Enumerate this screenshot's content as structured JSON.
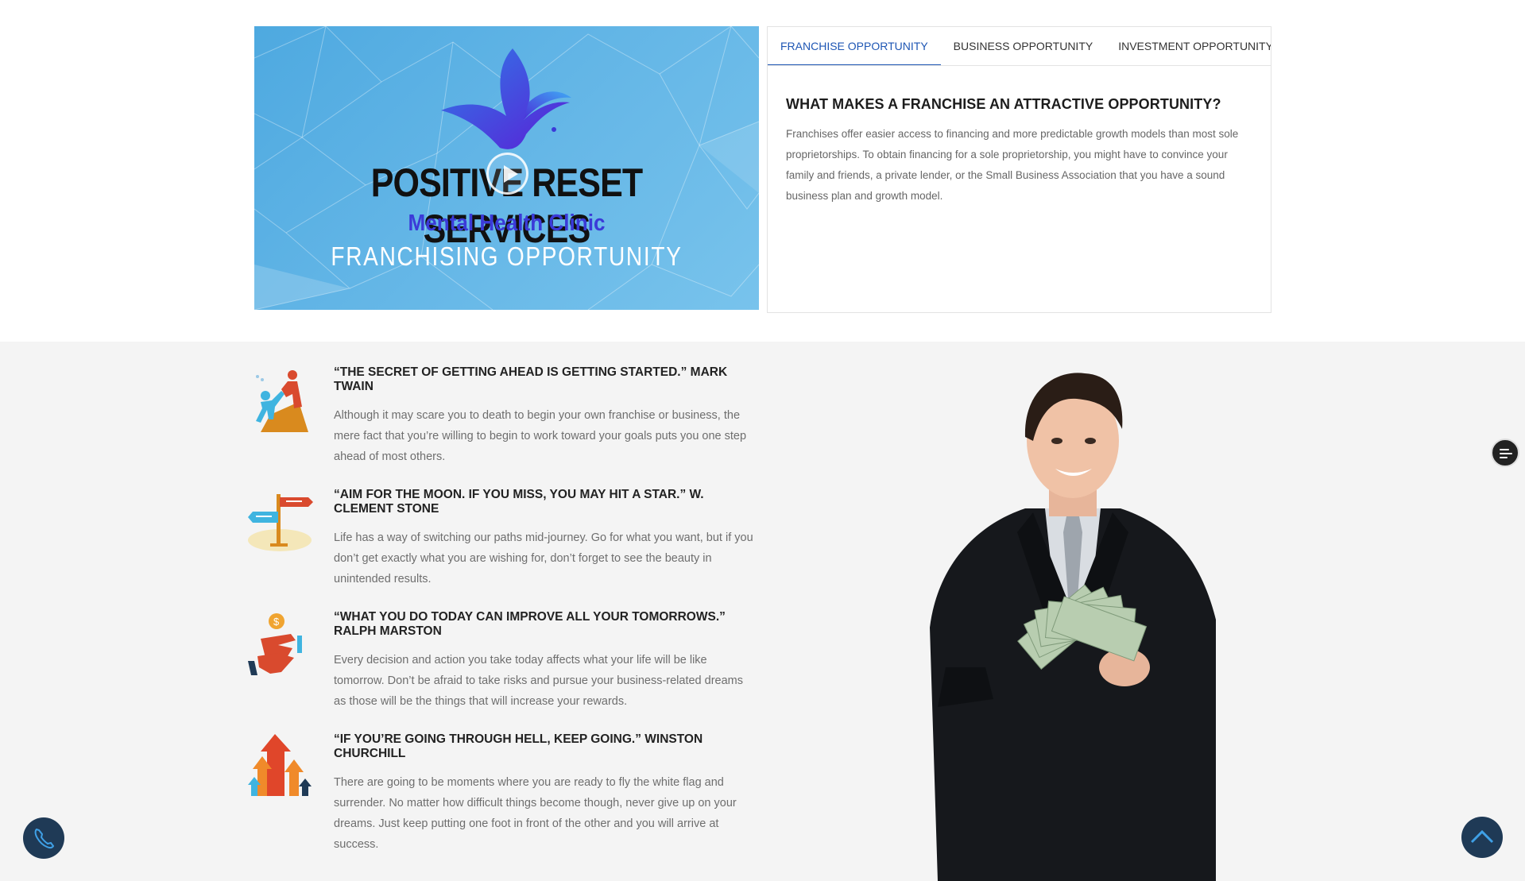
{
  "video": {
    "title": "POSITIVE RESET SERVICES",
    "subtitle": "Mental Health Clinic",
    "tagline": "FRANCHISING  OPPORTUNITY",
    "icon": "play-icon"
  },
  "tabs": {
    "items": [
      {
        "label": "FRANCHISE OPPORTUNITY"
      },
      {
        "label": "BUSINESS OPPORTUNITY"
      },
      {
        "label": "INVESTMENT OPPORTUNITY"
      }
    ],
    "active_index": 0,
    "content": {
      "heading": "WHAT MAKES A FRANCHISE AN ATTRACTIVE OPPORTUNITY?",
      "body": "Franchises offer easier access to financing and more predictable growth models than most sole proprietorships. To obtain financing for a sole proprietorship, you might have to convince your family and friends, a private lender, or the Small Business Association that you have a sound business plan and growth model."
    }
  },
  "quotes": [
    {
      "icon": "helping-hand-icon",
      "title": "“THE SECRET OF GETTING AHEAD IS GETTING STARTED.” MARK TWAIN",
      "body": "Although it may scare you to death to begin your own franchise or business, the mere fact that you’re willing to begin to work toward your goals puts you one step ahead of most others."
    },
    {
      "icon": "signpost-icon",
      "title": "“AIM FOR THE MOON. IF YOU MISS, YOU MAY HIT A STAR.” W. CLEMENT STONE",
      "body": "Life has a way of switching our paths mid-journey. Go for what you want, but if you don’t get exactly what you are wishing for, don’t forget to see the beauty in unintended results."
    },
    {
      "icon": "hand-coin-icon",
      "title": "“WHAT YOU DO TODAY CAN IMPROVE ALL YOUR TOMORROWS.” RALPH MARSTON",
      "body": "Every decision and action you take today affects what your life will be like tomorrow. Don’t be afraid to take risks and pursue your business-related dreams as those will be the things that will increase your rewards."
    },
    {
      "icon": "growth-arrows-icon",
      "title": "“IF YOU’RE GOING THROUGH HELL, KEEP GOING.” WINSTON CHURCHILL",
      "body": "There are going to be moments where you are ready to fly the white flag and surrender. No matter how difficult things become though, never give up on your dreams. Just keep putting one foot in front of the other and you will arrive at success."
    }
  ],
  "floating": {
    "call_icon": "phone-icon",
    "top_icon": "chevron-up-icon",
    "side_icon": "menu-filter-icon"
  },
  "colors": {
    "accent": "#1e56b4",
    "float_button": "#1f3a56",
    "section_bg": "#f4f4f4"
  }
}
